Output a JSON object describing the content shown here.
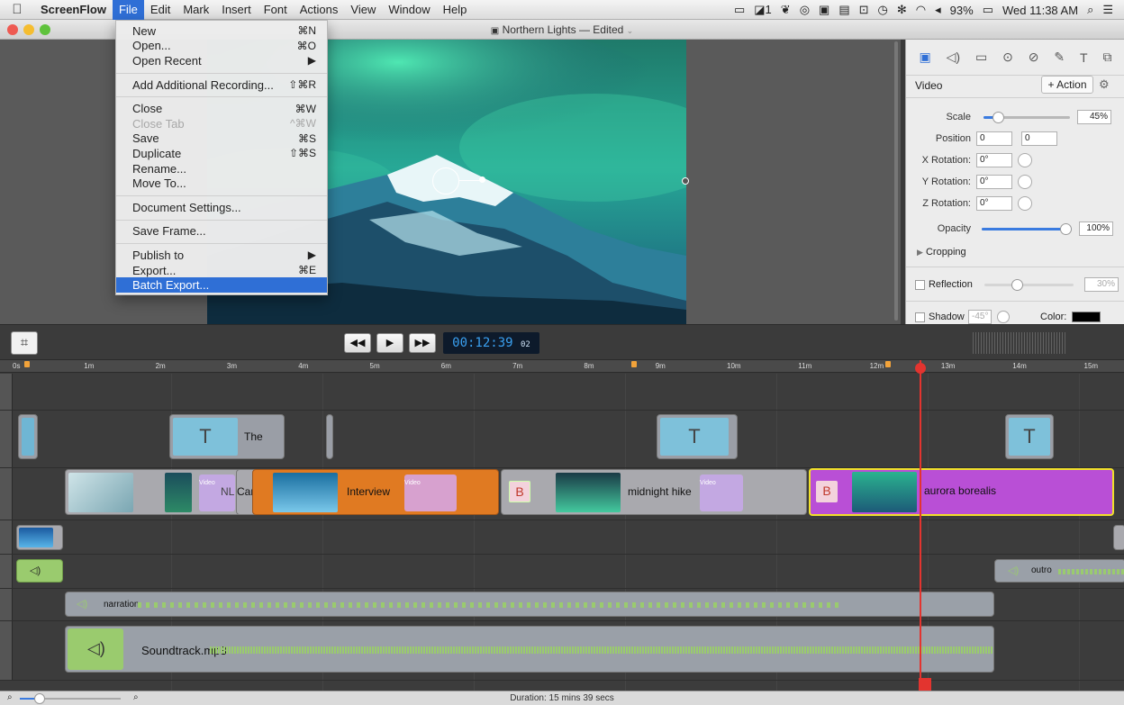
{
  "menubar": {
    "app_name": "ScreenFlow",
    "items": [
      "File",
      "Edit",
      "Mark",
      "Insert",
      "Font",
      "Actions",
      "View",
      "Window",
      "Help"
    ],
    "status": {
      "battery": "93%",
      "clock": "Wed 11:38 AM",
      "display_label": "1"
    }
  },
  "window": {
    "title": "Northern Lights — Edited"
  },
  "file_menu": {
    "rows": [
      {
        "label": "New",
        "shortcut": "⌘N"
      },
      {
        "label": "Open...",
        "shortcut": "⌘O"
      },
      {
        "label": "Open Recent",
        "shortcut": "▶"
      },
      {
        "label": "Add Additional Recording...",
        "shortcut": "⇧⌘R"
      },
      {
        "label": "Close",
        "shortcut": "⌘W"
      },
      {
        "label": "Close Tab",
        "shortcut": "^⌘W"
      },
      {
        "label": "Save",
        "shortcut": "⌘S"
      },
      {
        "label": "Duplicate",
        "shortcut": "⇧⌘S"
      },
      {
        "label": "Rename...",
        "shortcut": ""
      },
      {
        "label": "Move To...",
        "shortcut": ""
      },
      {
        "label": "Document Settings...",
        "shortcut": ""
      },
      {
        "label": "Save Frame...",
        "shortcut": ""
      },
      {
        "label": "Publish to",
        "shortcut": "▶"
      },
      {
        "label": "Export...",
        "shortcut": "⌘E"
      },
      {
        "label": "Batch Export...",
        "shortcut": ""
      }
    ]
  },
  "inspector": {
    "section": "Video",
    "action_button": "+ Action",
    "scale": {
      "label": "Scale",
      "value": "45%",
      "level": 0.12
    },
    "position": {
      "label": "Position",
      "x": "0",
      "y": "0"
    },
    "x_rotation": {
      "label": "X Rotation:",
      "value": "0°"
    },
    "y_rotation": {
      "label": "Y Rotation:",
      "value": "0°"
    },
    "z_rotation": {
      "label": "Z Rotation:",
      "value": "0°"
    },
    "opacity": {
      "label": "Opacity",
      "value": "100%",
      "level": 1.0
    },
    "cropping": "Cropping",
    "reflection": {
      "label": "Reflection",
      "value": "30%"
    },
    "shadow": {
      "label": "Shadow",
      "angle": "-45°",
      "color_label": "Color:"
    }
  },
  "transport": {
    "timecode": "00:12:39",
    "frames": "02"
  },
  "ruler": {
    "marks": [
      "0s",
      "1m",
      "2m",
      "3m",
      "4m",
      "5m",
      "6m",
      "7m",
      "8m",
      "9m",
      "10m",
      "11m",
      "12m",
      "13m",
      "14m",
      "15m"
    ]
  },
  "clips": {
    "text_clip_1": "The",
    "video_nl": "NL",
    "video_car": "Car",
    "interview": "Interview",
    "midnight_hike": "midnight hike",
    "aurora_borealis": "aurora borealis",
    "video_badge": "Video",
    "outro": "outro",
    "narration": "narration",
    "soundtrack": "Soundtrack.mp3"
  },
  "footer": {
    "duration": "Duration: 15 mins 39 secs"
  },
  "colors": {
    "accent": "#2f6fd6",
    "orange_clip": "#e07a22",
    "purple_clip": "#b94fd6",
    "video_clip": "#a9a9ae",
    "audio_clip": "#9aa0a8",
    "playhead": "#e3342f"
  }
}
